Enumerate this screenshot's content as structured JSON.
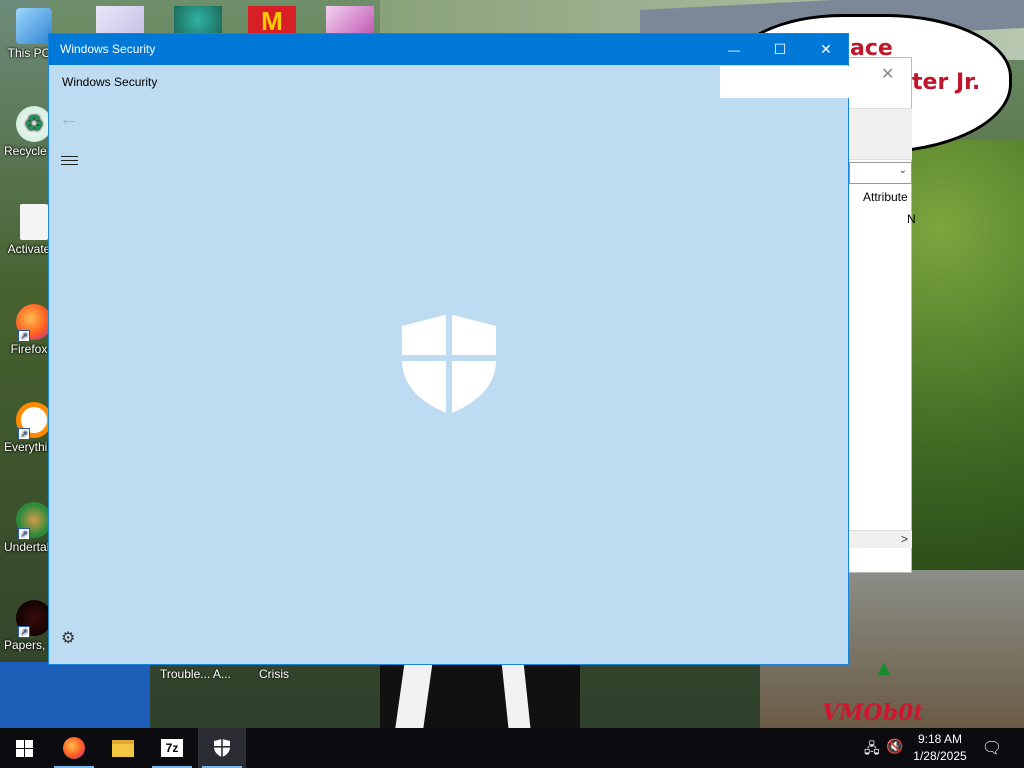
{
  "window": {
    "title": "Windows Security",
    "app_name": "Windows Security",
    "minimize": "—",
    "maximize": "☐",
    "close": "✕",
    "back": "←",
    "settings": "⚙"
  },
  "desktop": {
    "icons": [
      {
        "label": "This PC",
        "icon": "computer-icon"
      },
      {
        "label": "Recycle Bin",
        "icon": "recycle-bin-icon"
      },
      {
        "label": "Activate",
        "icon": "document-icon"
      },
      {
        "label": "Firefox",
        "icon": "firefox-icon"
      },
      {
        "label": "Everything",
        "icon": "search-icon"
      },
      {
        "label": "Undertale",
        "icon": "game-icon"
      },
      {
        "label": "Papers, Please",
        "icon": "game-icon"
      }
    ],
    "bottom_labels": [
      "Trouble... A...",
      "Crisis"
    ],
    "bubble_line1": "ace",
    "bubble_line2": "ter Jr.",
    "watermark": "VMOb0t"
  },
  "background_window": {
    "close": "✕",
    "column_header": "Attribute",
    "column_value": "N",
    "dropdown_arrow": "⌄",
    "scroll_arrow": ">"
  },
  "taskbar": {
    "apps": [
      {
        "name": "Start",
        "icon": "windows-logo-icon"
      },
      {
        "name": "Firefox",
        "icon": "firefox-icon"
      },
      {
        "name": "File Explorer",
        "icon": "folder-icon"
      },
      {
        "name": "7-Zip",
        "icon": "7zip-icon",
        "label": "7z"
      },
      {
        "name": "Windows Security",
        "icon": "shield-icon",
        "active": true
      }
    ],
    "time": "9:18 AM",
    "date": "1/28/2025"
  },
  "colors": {
    "titlebar": "#0078d7",
    "window_bg": "#bddcf2",
    "taskbar": "#0b0b10"
  }
}
